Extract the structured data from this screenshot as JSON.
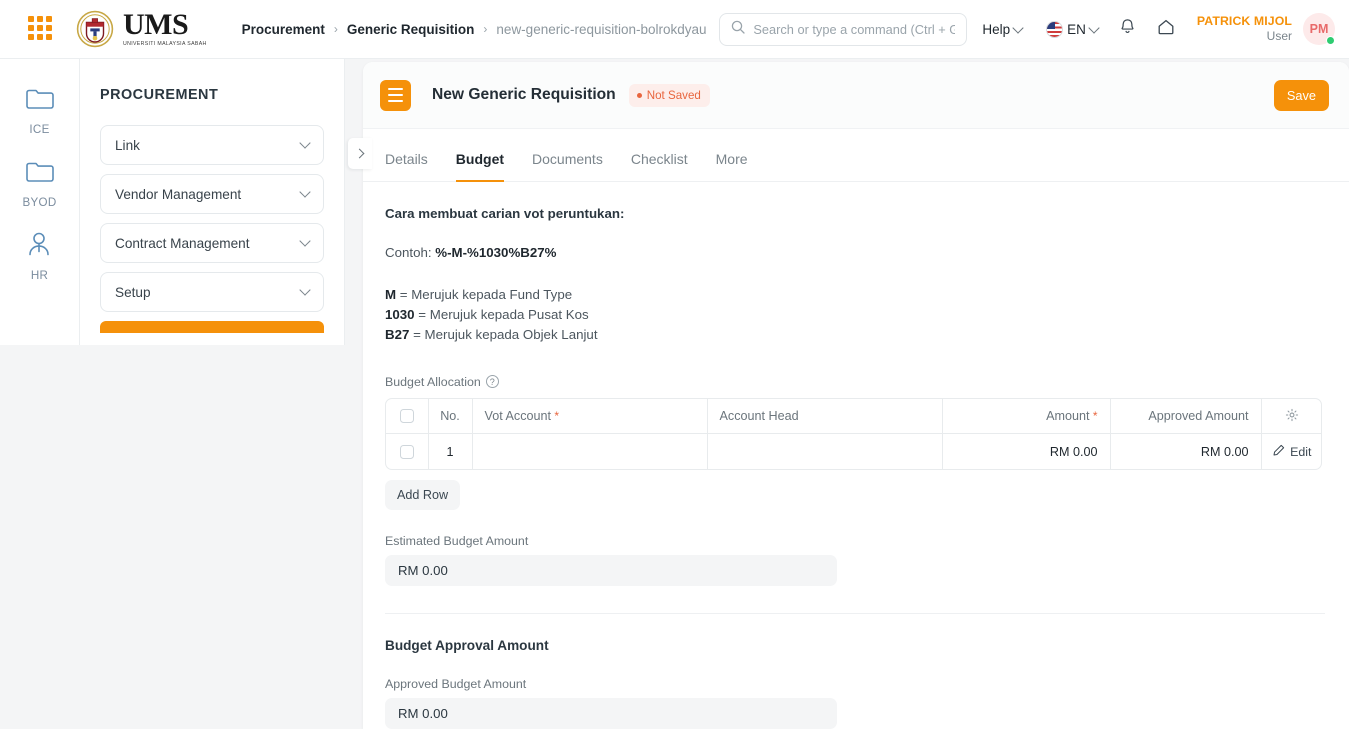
{
  "navbar": {
    "apps_icon": "apps-grid-icon",
    "brand": {
      "name": "UMS",
      "subtitle": "UNIVERSITI MALAYSIA SABAH"
    },
    "breadcrumb": [
      {
        "label": "Procurement",
        "muted": false
      },
      {
        "label": "Generic Requisition",
        "muted": false
      },
      {
        "label": "new-generic-requisition-bolrokdyau",
        "muted": true
      }
    ],
    "breadcrumb_separator": "›",
    "search": {
      "placeholder": "Search or type a command (Ctrl + G)",
      "value": "",
      "icon": "search-icon"
    },
    "help_label": "Help",
    "language_label": "EN",
    "notification_icon": "bell-icon",
    "home_icon": "home-icon",
    "user": {
      "name": "PATRICK MIJOL",
      "role": "User",
      "initials": "PM",
      "status": "online"
    }
  },
  "rail": {
    "items": [
      {
        "label": "ICE",
        "icon": "folder-icon"
      },
      {
        "label": "BYOD",
        "icon": "folder-icon"
      },
      {
        "label": "HR",
        "icon": "user-tie-icon"
      }
    ]
  },
  "sidebar": {
    "title": "PROCUREMENT",
    "items": [
      {
        "label": "Link"
      },
      {
        "label": "Vendor Management"
      },
      {
        "label": "Contract Management"
      },
      {
        "label": "Setup"
      }
    ],
    "accent_color": "#f5910a"
  },
  "document": {
    "title": "New Generic Requisition",
    "status_badge": "Not Saved",
    "save_label": "Save",
    "menu_icon": "hamburger-menu-icon",
    "collapse_icon": "chevron-right-icon"
  },
  "tabs": [
    {
      "label": "Details",
      "active": false
    },
    {
      "label": "Budget",
      "active": true
    },
    {
      "label": "Documents",
      "active": false
    },
    {
      "label": "Checklist",
      "active": false
    },
    {
      "label": "More",
      "active": false
    }
  ],
  "budget": {
    "hint_heading": "Cara membuat carian vot peruntukan:",
    "hint_example_prefix": "Contoh: ",
    "hint_example_code": "%-M-%1030%B27%",
    "hint_lines": [
      {
        "code": "M",
        "text": " = Merujuk kepada Fund Type"
      },
      {
        "code": "1030",
        "text": " = Merujuk kepada Pusat Kos"
      },
      {
        "code": "B27",
        "text": " = Merujuk kepada Objek Lanjut"
      }
    ],
    "allocation_label": "Budget Allocation",
    "allocation_help_icon": "help-circle-icon",
    "table": {
      "columns": [
        "No.",
        "Vot Account",
        "Account Head",
        "Amount",
        "Approved Amount"
      ],
      "required_columns": [
        "Vot Account",
        "Amount"
      ],
      "settings_icon": "gear-icon",
      "rows": [
        {
          "no": "1",
          "vot_account": "",
          "account_head": "",
          "amount": "RM 0.00",
          "approved_amount": "RM 0.00",
          "edit_label": "Edit",
          "edit_icon": "pencil-icon"
        }
      ]
    },
    "add_row_label": "Add Row",
    "estimated_label": "Estimated Budget Amount",
    "estimated_value": "RM 0.00",
    "approval_section_title": "Budget Approval Amount",
    "approved_label": "Approved Budget Amount",
    "approved_value": "RM 0.00"
  }
}
